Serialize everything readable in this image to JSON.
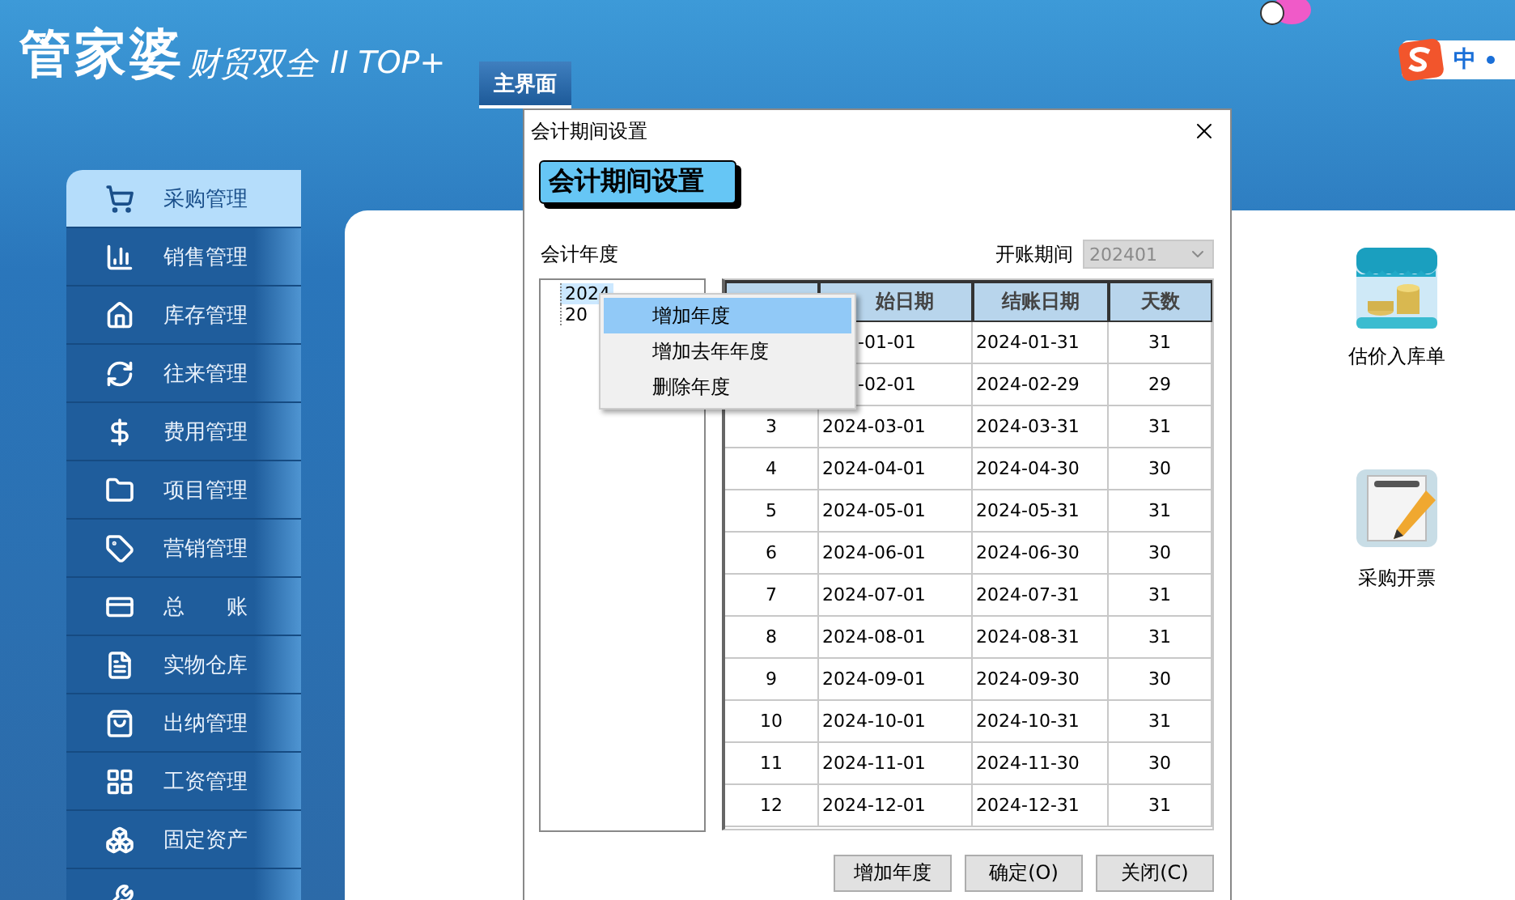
{
  "app": {
    "logo": "管家婆",
    "tagline": "财贸双全",
    "edition": "II TOP+",
    "tabs": [
      {
        "label": "主界面",
        "selected": true
      }
    ]
  },
  "ime": {
    "label": "中"
  },
  "sidebar": {
    "items": [
      {
        "label": "采购管理",
        "selected": true
      },
      {
        "label": "销售管理",
        "selected": false
      },
      {
        "label": "库存管理",
        "selected": false
      },
      {
        "label": "往来管理",
        "selected": false
      },
      {
        "label": "费用管理",
        "selected": false
      },
      {
        "label": "项目管理",
        "selected": false
      },
      {
        "label": "营销管理",
        "selected": false
      },
      {
        "label": "总　　账",
        "selected": false
      },
      {
        "label": "实物仓库",
        "selected": false
      },
      {
        "label": "出纳管理",
        "selected": false
      },
      {
        "label": "工资管理",
        "selected": false
      },
      {
        "label": "固定资产",
        "selected": false
      },
      {
        "selected": false
      }
    ]
  },
  "desktop": {
    "shortcuts": [
      {
        "label": "估价入库单"
      },
      {
        "label": "采购开票"
      }
    ]
  },
  "dialog": {
    "title": "会计期间设置",
    "heading": "会计期间设置",
    "year_label": "会计年度",
    "opening_label": "开账期间",
    "opening_select": {
      "value": "202401",
      "disabled": true
    },
    "years": [
      {
        "label": "2024",
        "selected": true
      },
      {
        "label": "20",
        "selected": false
      }
    ],
    "table": {
      "columns": [
        {
          "label": "始日期",
          "kind": "partial"
        },
        {
          "label": "结账日期",
          "kind": "full"
        },
        {
          "label": "天数",
          "kind": "full"
        }
      ],
      "rows": [
        {
          "start": "-01-01",
          "end": "2024-01-31",
          "days": "31"
        },
        {
          "start": "-02-01",
          "end": "2024-02-29",
          "days": "29"
        },
        {
          "no": "3",
          "start": "2024-03-01",
          "end": "2024-03-31",
          "days": "31"
        },
        {
          "no": "4",
          "start": "2024-04-01",
          "end": "2024-04-30",
          "days": "30"
        },
        {
          "no": "5",
          "start": "2024-05-01",
          "end": "2024-05-31",
          "days": "31"
        },
        {
          "no": "6",
          "start": "2024-06-01",
          "end": "2024-06-30",
          "days": "30"
        },
        {
          "no": "7",
          "start": "2024-07-01",
          "end": "2024-07-31",
          "days": "31"
        },
        {
          "no": "8",
          "start": "2024-08-01",
          "end": "2024-08-31",
          "days": "31"
        },
        {
          "no": "9",
          "start": "2024-09-01",
          "end": "2024-09-30",
          "days": "30"
        },
        {
          "no": "10",
          "start": "2024-10-01",
          "end": "2024-10-31",
          "days": "31"
        },
        {
          "no": "11",
          "start": "2024-11-01",
          "end": "2024-11-30",
          "days": "30"
        },
        {
          "no": "12",
          "start": "2024-12-01",
          "end": "2024-12-31",
          "days": "31"
        }
      ]
    },
    "context_menu": [
      {
        "label": "增加年度",
        "selected": true
      },
      {
        "label": "增加去年年度",
        "selected": false
      },
      {
        "label": "删除年度",
        "selected": false
      }
    ],
    "buttons": [
      "增加年度",
      "确定(O)",
      "关闭(C)"
    ]
  }
}
